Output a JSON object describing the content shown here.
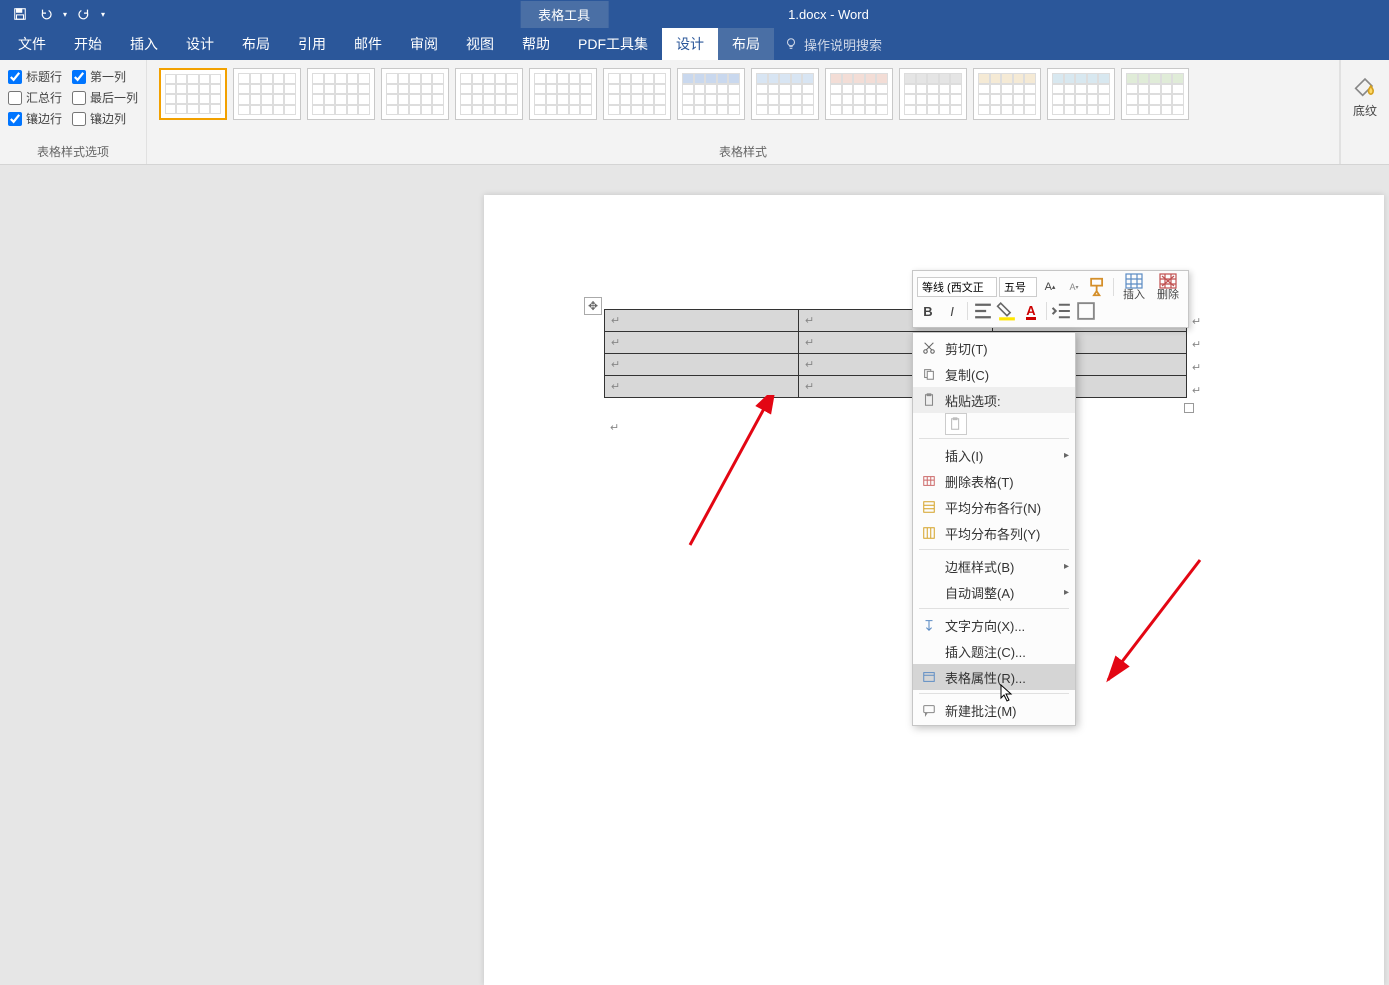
{
  "titlebar": {
    "context_tab": "表格工具",
    "doc_title": "1.docx - Word"
  },
  "tabs": {
    "file": "文件",
    "home": "开始",
    "insert": "插入",
    "design_main": "设计",
    "layout_main": "布局",
    "references": "引用",
    "mailings": "邮件",
    "review": "审阅",
    "view": "视图",
    "help": "帮助",
    "pdf": "PDF工具集",
    "design": "设计",
    "layout": "布局",
    "tell_me": "操作说明搜索"
  },
  "ribbon": {
    "style_options": {
      "header_row": "标题行",
      "first_col": "第一列",
      "total_row": "汇总行",
      "last_col": "最后一列",
      "banded_rows": "镶边行",
      "banded_cols": "镶边列",
      "group_label": "表格样式选项"
    },
    "table_styles_label": "表格样式",
    "shading": "底纹"
  },
  "mini_toolbar": {
    "font": "等线 (西文正",
    "size": "五号",
    "insert": "插入",
    "delete": "删除"
  },
  "context_menu": {
    "cut": "剪切(T)",
    "copy": "复制(C)",
    "paste_options": "粘贴选项:",
    "insert": "插入(I)",
    "delete_table": "删除表格(T)",
    "distribute_rows": "平均分布各行(N)",
    "distribute_cols": "平均分布各列(Y)",
    "border_style": "边框样式(B)",
    "autofit": "自动调整(A)",
    "text_direction": "文字方向(X)...",
    "insert_caption": "插入题注(C)...",
    "table_properties": "表格属性(R)...",
    "new_comment": "新建批注(M)"
  }
}
